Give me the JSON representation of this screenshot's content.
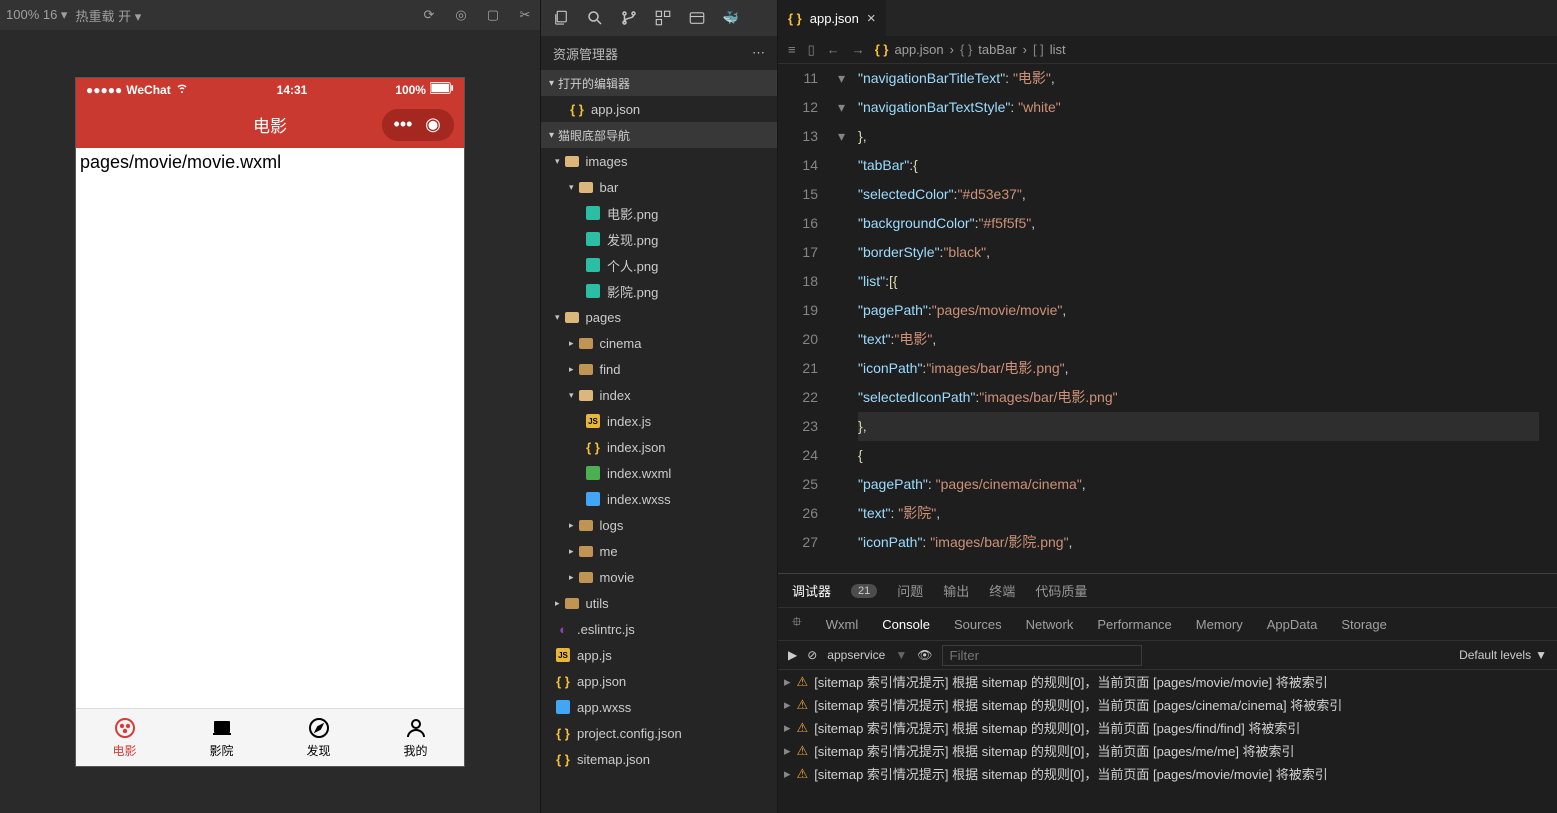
{
  "simToolbar": {
    "zoom": "100% 16 ▾",
    "hotReload": "热重载 开 ▾"
  },
  "phone": {
    "wechat": "WeChat",
    "signal": "●●●●●",
    "time": "14:31",
    "battery": "100%",
    "navTitle": "电影",
    "bodyPath": "pages/movie/movie.wxml",
    "tabs": [
      "电影",
      "影院",
      "发现",
      "我的"
    ]
  },
  "explorer": {
    "title": "资源管理器",
    "sections": {
      "openEditors": "打开的编辑器",
      "project": "猫眼底部导航"
    },
    "openFile": "app.json",
    "tree": {
      "images": "images",
      "bar": "bar",
      "barFiles": [
        "电影.png",
        "发现.png",
        "个人.png",
        "影院.png"
      ],
      "pages": "pages",
      "pageFolders": [
        "cinema",
        "find",
        "index",
        "logs",
        "me",
        "movie"
      ],
      "indexFiles": [
        "index.js",
        "index.json",
        "index.wxml",
        "index.wxss"
      ],
      "utils": "utils",
      "rootFiles": [
        ".eslintrc.js",
        "app.js",
        "app.json",
        "app.wxss",
        "project.config.json",
        "sitemap.json"
      ]
    }
  },
  "editor": {
    "tabName": "app.json",
    "breadcrumb": [
      "app.json",
      "tabBar",
      "list"
    ],
    "lines": [
      {
        "num": 11,
        "tokens": [
          [
            "        ",
            ""
          ],
          [
            "\"navigationBarTitleText\"",
            "prop"
          ],
          [
            ": ",
            "punc"
          ],
          [
            "\"电影\"",
            "str"
          ],
          [
            ",",
            "punc"
          ]
        ]
      },
      {
        "num": 12,
        "tokens": [
          [
            "        ",
            ""
          ],
          [
            "\"navigationBarTextStyle\"",
            "prop"
          ],
          [
            ": ",
            "punc"
          ],
          [
            "\"white\"",
            "str"
          ]
        ]
      },
      {
        "num": 13,
        "tokens": [
          [
            "    ",
            ""
          ],
          [
            "}",
            "brace"
          ],
          [
            ",",
            "punc"
          ]
        ]
      },
      {
        "num": 14,
        "fold": "▾",
        "tokens": [
          [
            "    ",
            ""
          ],
          [
            "\"tabBar\"",
            "prop"
          ],
          [
            ":",
            "punc"
          ],
          [
            "{",
            "brace"
          ]
        ]
      },
      {
        "num": 15,
        "tokens": [
          [
            "        ",
            ""
          ],
          [
            "\"selectedColor\"",
            "prop"
          ],
          [
            ":",
            "punc"
          ],
          [
            "\"#d53e37\"",
            "str"
          ],
          [
            ",",
            "punc"
          ]
        ]
      },
      {
        "num": 16,
        "tokens": [
          [
            "        ",
            ""
          ],
          [
            "\"backgroundColor\"",
            "prop"
          ],
          [
            ":",
            "punc"
          ],
          [
            "\"#f5f5f5\"",
            "str"
          ],
          [
            ",",
            "punc"
          ]
        ]
      },
      {
        "num": 17,
        "tokens": [
          [
            "        ",
            ""
          ],
          [
            "\"borderStyle\"",
            "prop"
          ],
          [
            ":",
            "punc"
          ],
          [
            "\"black\"",
            "str"
          ],
          [
            ",",
            "punc"
          ]
        ]
      },
      {
        "num": 18,
        "fold": "▾",
        "tokens": [
          [
            "        ",
            ""
          ],
          [
            "\"list\"",
            "prop"
          ],
          [
            ":",
            "punc"
          ],
          [
            "[",
            "brace"
          ],
          [
            "{",
            "brace"
          ]
        ]
      },
      {
        "num": 19,
        "tokens": [
          [
            "            ",
            ""
          ],
          [
            "\"pagePath\"",
            "prop"
          ],
          [
            ":",
            "punc"
          ],
          [
            "\"pages/movie/movie\"",
            "str"
          ],
          [
            ",",
            "punc"
          ]
        ]
      },
      {
        "num": 20,
        "tokens": [
          [
            "            ",
            ""
          ],
          [
            "\"text\"",
            "prop"
          ],
          [
            ":",
            "punc"
          ],
          [
            "\"电影\"",
            "str"
          ],
          [
            ",",
            "punc"
          ]
        ]
      },
      {
        "num": 21,
        "tokens": [
          [
            "            ",
            ""
          ],
          [
            "\"iconPath\"",
            "prop"
          ],
          [
            ":",
            "punc"
          ],
          [
            "\"images/bar/电影.png\"",
            "str"
          ],
          [
            ",",
            "punc"
          ]
        ]
      },
      {
        "num": 22,
        "tokens": [
          [
            "            ",
            ""
          ],
          [
            "\"selectedIconPath\"",
            "prop"
          ],
          [
            ":",
            "punc"
          ],
          [
            "\"images/bar/电影.png\"",
            "str"
          ]
        ]
      },
      {
        "num": 23,
        "hl": true,
        "tokens": [
          [
            "        ",
            ""
          ],
          [
            "}",
            "brace"
          ],
          [
            ",",
            "punc"
          ]
        ]
      },
      {
        "num": 24,
        "fold": "▾",
        "tokens": [
          [
            "        ",
            ""
          ],
          [
            "{",
            "brace"
          ]
        ]
      },
      {
        "num": 25,
        "tokens": [
          [
            "            ",
            ""
          ],
          [
            "\"pagePath\"",
            "prop"
          ],
          [
            ": ",
            "punc"
          ],
          [
            "\"pages/cinema/cinema\"",
            "str"
          ],
          [
            ",",
            "punc"
          ]
        ]
      },
      {
        "num": 26,
        "tokens": [
          [
            "            ",
            ""
          ],
          [
            "\"text\"",
            "prop"
          ],
          [
            ": ",
            "punc"
          ],
          [
            "\"影院\"",
            "str"
          ],
          [
            ",",
            "punc"
          ]
        ]
      },
      {
        "num": 27,
        "tokens": [
          [
            "            ",
            ""
          ],
          [
            "\"iconPath\"",
            "prop"
          ],
          [
            ": ",
            "punc"
          ],
          [
            "\"images/bar/影院.png\"",
            "str"
          ],
          [
            ",",
            "punc"
          ]
        ]
      }
    ]
  },
  "bottomPanel": {
    "tabs": {
      "debugger": "调试器",
      "badge": "21",
      "problems": "问题",
      "output": "输出",
      "terminal": "终端",
      "quality": "代码质量"
    },
    "devTabs": [
      "Wxml",
      "Console",
      "Sources",
      "Network",
      "Performance",
      "Memory",
      "AppData",
      "Storage"
    ],
    "consoleBar": {
      "context": "appservice",
      "filterPlaceholder": "Filter",
      "levels": "Default levels"
    },
    "logs": [
      "▸ ⚠ [sitemap 索引情况提示] 根据 sitemap 的规则[0]，当前页面 [pages/movie/movie] 将被索引",
      "▸ ⚠ [sitemap 索引情况提示] 根据 sitemap 的规则[0]，当前页面 [pages/cinema/cinema] 将被索引",
      "▸ ⚠ [sitemap 索引情况提示] 根据 sitemap 的规则[0]，当前页面 [pages/find/find] 将被索引",
      "▸ ⚠ [sitemap 索引情况提示] 根据 sitemap 的规则[0]，当前页面 [pages/me/me] 将被索引",
      "▸ ⚠ [sitemap 索引情况提示] 根据 sitemap 的规则[0]，当前页面 [pages/movie/movie] 将被索引"
    ]
  }
}
